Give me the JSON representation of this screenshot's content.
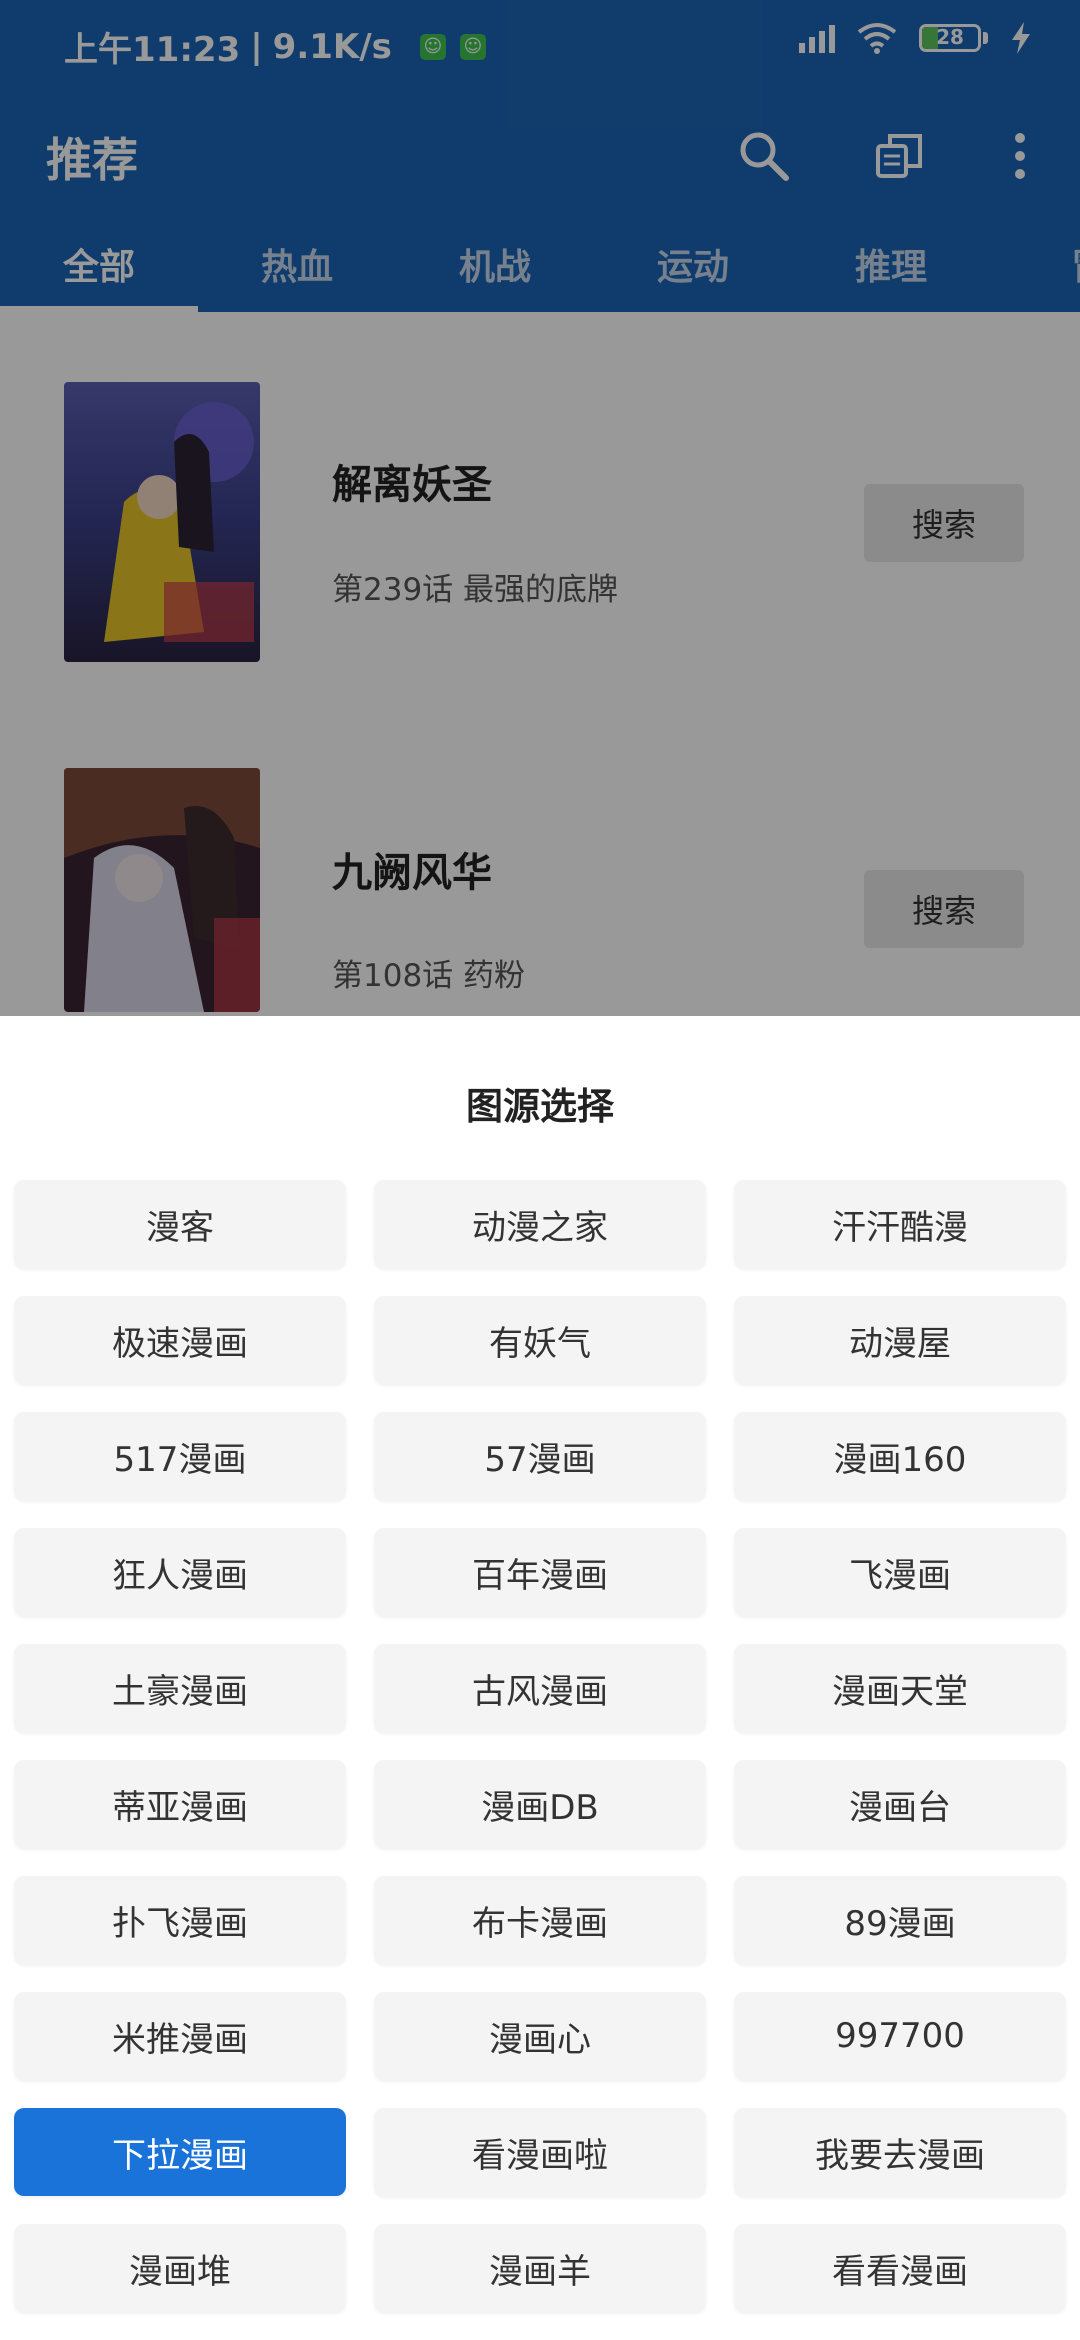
{
  "status_bar": {
    "time": "上午11:23",
    "speed": "9.1K/s",
    "battery": "28",
    "battery_level": 0.28
  },
  "toolbar": {
    "title": "推荐",
    "icons": [
      "search-icon",
      "copy-icon",
      "more-vertical-icon"
    ]
  },
  "tabs": [
    {
      "label": "全部",
      "active": true
    },
    {
      "label": "热血",
      "active": false
    },
    {
      "label": "机战",
      "active": false
    },
    {
      "label": "运动",
      "active": false
    },
    {
      "label": "推理",
      "active": false
    },
    {
      "label": "冒",
      "active": false
    }
  ],
  "comics": [
    {
      "title": "解离妖圣",
      "chapter": "第239话 最强的底牌",
      "button": "搜索"
    },
    {
      "title": "九阙风华",
      "chapter": "第108话 药粉",
      "button": "搜索"
    }
  ],
  "sheet": {
    "title": "图源选择",
    "selected_index": 24,
    "sources": [
      "漫客",
      "动漫之家",
      "汗汗酷漫",
      "极速漫画",
      "有妖气",
      "动漫屋",
      "517漫画",
      "57漫画",
      "漫画160",
      "狂人漫画",
      "百年漫画",
      "飞漫画",
      "土豪漫画",
      "古风漫画",
      "漫画天堂",
      "蒂亚漫画",
      "漫画DB",
      "漫画台",
      "扑飞漫画",
      "布卡漫画",
      "89漫画",
      "米推漫画",
      "漫画心",
      "997700",
      "下拉漫画",
      "看漫画啦",
      "我要去漫画",
      "漫画堆",
      "漫画羊",
      "看看漫画"
    ]
  },
  "colors": {
    "primary": "#1a65b4",
    "selected": "#1a73d9"
  }
}
